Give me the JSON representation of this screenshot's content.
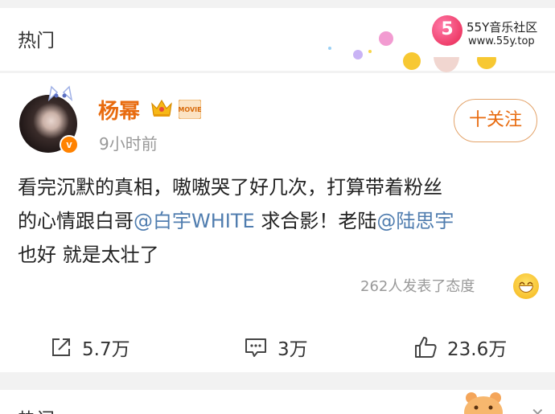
{
  "section_top": {
    "title": "热门"
  },
  "watermark": {
    "name": "55Y音乐社区",
    "url": "www.55y.top",
    "logo_glyph": "5"
  },
  "post": {
    "author": "杨幂",
    "time": "9小时前",
    "follow_label": "十关注",
    "text_line1": "看完沉默的真相，嗷嗷哭了好几次，打算带着粉丝",
    "text_line2_a": "的心情跟白哥",
    "mention1": "@白宇WHITE",
    "text_line2_b": " 求合影！老陆",
    "mention2": "@陆思宇",
    "text_line3": "也好 就是太壮了",
    "reactions": "262人发表了态度",
    "badge_glyph": "v",
    "movie_label": "MOVIE"
  },
  "actions": {
    "share_count": "5.7万",
    "comment_count": "3万",
    "like_count": "23.6万"
  },
  "section_bottom": {
    "title": "热门"
  },
  "colors": {
    "accent": "#e86b0f",
    "mention": "#507daf",
    "muted": "#999999",
    "badge": "#ff8200"
  },
  "icons": [
    "share-icon",
    "comment-icon",
    "like-icon",
    "crown-icon",
    "verified-icon",
    "smiley-icon",
    "close-icon"
  ]
}
